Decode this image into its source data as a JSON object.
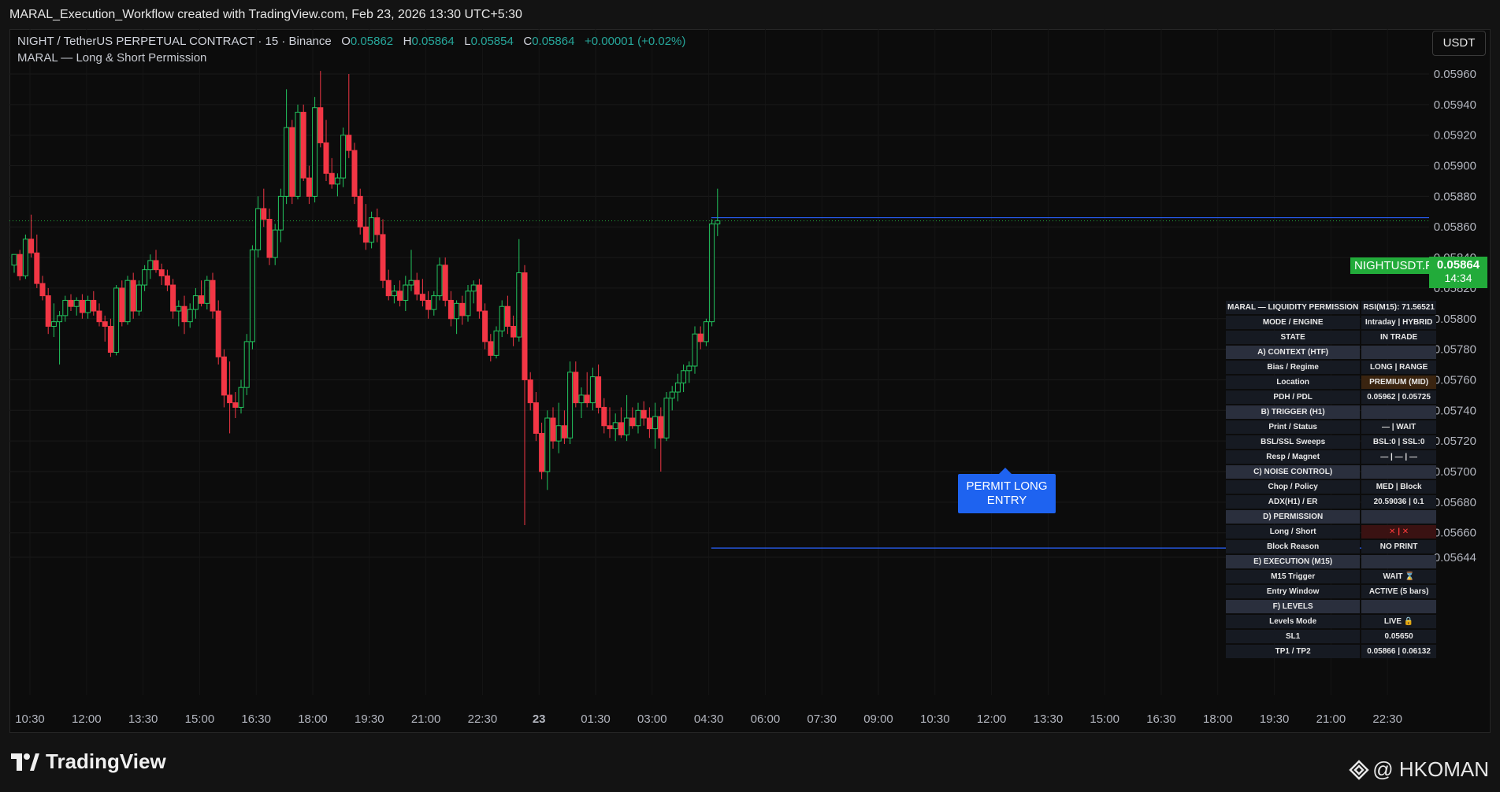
{
  "window": {
    "title": "MARAL_Execution_Workflow created with TradingView.com, Feb 23, 2026 13:30 UTC+5:30"
  },
  "legend": {
    "symbol": "NIGHT / TetherUS PERPETUAL CONTRACT · 15 · Binance",
    "o_label": "O",
    "o_value": "0.05862",
    "h_label": "H",
    "h_value": "0.05864",
    "l_label": "L",
    "l_value": "0.05854",
    "c_label": "C",
    "c_value": "0.05864",
    "change": "+0.00001 (+0.02%)",
    "indicator": "MARAL — Long & Short Permission"
  },
  "currency_button": "USDT",
  "last_price": {
    "symbol": "NIGHTUSDT.P",
    "price": "0.05864",
    "countdown": "14:34"
  },
  "signal_label": {
    "line1": "PERMIT LONG",
    "line2": "ENTRY"
  },
  "dashboard": {
    "rows": [
      {
        "k": "MARAL — LIQUIDITY PERMISSION",
        "v": "RSI(M15): 71.56521",
        "type": "header"
      },
      {
        "k": "MODE / ENGINE",
        "v": "Intraday | HYBRID"
      },
      {
        "k": "STATE",
        "v": "IN TRADE"
      },
      {
        "k": "A) CONTEXT (HTF)",
        "v": "",
        "type": "section"
      },
      {
        "k": "Bias / Regime",
        "v": "LONG | RANGE"
      },
      {
        "k": "Location",
        "v": "PREMIUM (MID)",
        "hl": "prem"
      },
      {
        "k": "PDH / PDL",
        "v": "0.05962 | 0.05725"
      },
      {
        "k": "B) TRIGGER (H1)",
        "v": "",
        "type": "section"
      },
      {
        "k": "Print / Status",
        "v": "— | WAIT"
      },
      {
        "k": "BSL/SSL Sweeps",
        "v": "BSL:0 | SSL:0"
      },
      {
        "k": "Resp / Magnet",
        "v": "— | — | —"
      },
      {
        "k": "C) NOISE CONTROL)",
        "v": "",
        "type": "section"
      },
      {
        "k": "Chop / Policy",
        "v": "MED | Block"
      },
      {
        "k": "ADX(H1) / ER",
        "v": "20.59036 | 0.1"
      },
      {
        "k": "D) PERMISSION",
        "v": "",
        "type": "section"
      },
      {
        "k": "Long / Short",
        "v": "✕ | ✕",
        "hl": "perm"
      },
      {
        "k": "Block Reason",
        "v": "NO PRINT"
      },
      {
        "k": "E) EXECUTION (M15)",
        "v": "",
        "type": "section"
      },
      {
        "k": "M15 Trigger",
        "v": "WAIT ⌛"
      },
      {
        "k": "Entry Window",
        "v": "ACTIVE (5 bars)"
      },
      {
        "k": "F) LEVELS",
        "v": "",
        "type": "section"
      },
      {
        "k": "Levels Mode",
        "v": "LIVE 🔒"
      },
      {
        "k": "SL1",
        "v": "0.05650"
      },
      {
        "k": "TP1 / TP2",
        "v": "0.05866 | 0.06132"
      }
    ]
  },
  "branding": {
    "logo_text": "TradingView",
    "watermark": "@ HKOMAN"
  },
  "colors": {
    "up": "#26a69a",
    "bull_body": "#0c0c0c",
    "bull_outline": "#22c55e",
    "down": "#f23645",
    "accent": "#2962ff",
    "last_price_bg": "#22ab3a"
  },
  "chart_data": {
    "type": "candlestick",
    "interval": "15",
    "exchange": "Binance",
    "ylim": [
      0.0564,
      0.0597
    ],
    "y_ticks": [
      "0.05960",
      "0.05940",
      "0.05920",
      "0.05900",
      "0.05880",
      "0.05860",
      "0.05840",
      "0.05820",
      "0.05800",
      "0.05780",
      "0.05760",
      "0.05740",
      "0.05720",
      "0.05700",
      "0.05680",
      "0.05660",
      "0.05644"
    ],
    "x_ticks": [
      "10:30",
      "12:00",
      "13:30",
      "15:00",
      "16:30",
      "18:00",
      "19:30",
      "21:00",
      "22:30",
      "23",
      "01:30",
      "03:00",
      "04:30",
      "06:00",
      "07:30",
      "09:00",
      "10:30",
      "12:00",
      "13:30",
      "15:00",
      "16:30",
      "18:00",
      "19:30",
      "21:00",
      "22:30"
    ],
    "last_close": 0.05864,
    "levels": {
      "tp1": 0.05866,
      "sl1": 0.0565
    },
    "signal_index": 123,
    "candles": [
      [
        0.05835,
        0.05842,
        0.0583,
        0.05842
      ],
      [
        0.05842,
        0.05845,
        0.05825,
        0.05828
      ],
      [
        0.05828,
        0.05855,
        0.05826,
        0.05852
      ],
      [
        0.05852,
        0.05868,
        0.0584,
        0.05843
      ],
      [
        0.05843,
        0.05855,
        0.0582,
        0.05823
      ],
      [
        0.05823,
        0.05828,
        0.05812,
        0.05815
      ],
      [
        0.05815,
        0.0582,
        0.0579,
        0.05795
      ],
      [
        0.05795,
        0.0581,
        0.05788,
        0.05798
      ],
      [
        0.05798,
        0.05805,
        0.0577,
        0.05802
      ],
      [
        0.05802,
        0.05815,
        0.05798,
        0.05812
      ],
      [
        0.05812,
        0.05816,
        0.05805,
        0.05808
      ],
      [
        0.05808,
        0.05814,
        0.05802,
        0.05812
      ],
      [
        0.05812,
        0.05816,
        0.058,
        0.05804
      ],
      [
        0.05804,
        0.05815,
        0.058,
        0.05812
      ],
      [
        0.05812,
        0.05818,
        0.05802,
        0.05805
      ],
      [
        0.05805,
        0.0581,
        0.05795,
        0.05798
      ],
      [
        0.05798,
        0.05802,
        0.05785,
        0.05795
      ],
      [
        0.05795,
        0.058,
        0.05775,
        0.05778
      ],
      [
        0.05778,
        0.05822,
        0.05776,
        0.0582
      ],
      [
        0.0582,
        0.05825,
        0.05795,
        0.05798
      ],
      [
        0.05798,
        0.05828,
        0.05796,
        0.05825
      ],
      [
        0.05825,
        0.0583,
        0.058,
        0.05805
      ],
      [
        0.05805,
        0.05825,
        0.05802,
        0.05822
      ],
      [
        0.05822,
        0.05835,
        0.05818,
        0.05832
      ],
      [
        0.05832,
        0.05842,
        0.05826,
        0.05838
      ],
      [
        0.05838,
        0.05845,
        0.0583,
        0.05832
      ],
      [
        0.05832,
        0.05836,
        0.05822,
        0.05828
      ],
      [
        0.05828,
        0.05832,
        0.05818,
        0.05822
      ],
      [
        0.05822,
        0.05826,
        0.058,
        0.05805
      ],
      [
        0.05805,
        0.05812,
        0.05795,
        0.05808
      ],
      [
        0.05808,
        0.05815,
        0.0579,
        0.05798
      ],
      [
        0.05798,
        0.0581,
        0.05794,
        0.05806
      ],
      [
        0.05806,
        0.0582,
        0.058,
        0.05815
      ],
      [
        0.05815,
        0.05825,
        0.05808,
        0.0581
      ],
      [
        0.0581,
        0.05828,
        0.05806,
        0.05825
      ],
      [
        0.05825,
        0.0583,
        0.058,
        0.05805
      ],
      [
        0.05805,
        0.05812,
        0.0577,
        0.05775
      ],
      [
        0.05775,
        0.0578,
        0.05742,
        0.0575
      ],
      [
        0.0575,
        0.05772,
        0.05725,
        0.05745
      ],
      [
        0.05745,
        0.05752,
        0.05735,
        0.05742
      ],
      [
        0.05742,
        0.0576,
        0.05738,
        0.05755
      ],
      [
        0.05755,
        0.0579,
        0.0575,
        0.05785
      ],
      [
        0.05785,
        0.05848,
        0.0578,
        0.05845
      ],
      [
        0.05845,
        0.0588,
        0.0584,
        0.05872
      ],
      [
        0.05872,
        0.05885,
        0.0586,
        0.05865
      ],
      [
        0.05865,
        0.05872,
        0.05835,
        0.0584
      ],
      [
        0.0584,
        0.05862,
        0.05835,
        0.05858
      ],
      [
        0.05858,
        0.05885,
        0.0585,
        0.0588
      ],
      [
        0.0588,
        0.0595,
        0.05875,
        0.05925
      ],
      [
        0.05925,
        0.0593,
        0.05875,
        0.0588
      ],
      [
        0.0588,
        0.0594,
        0.05878,
        0.05935
      ],
      [
        0.05935,
        0.0594,
        0.0589,
        0.05892
      ],
      [
        0.05892,
        0.059,
        0.05875,
        0.0588
      ],
      [
        0.0588,
        0.05945,
        0.05876,
        0.05938
      ],
      [
        0.05938,
        0.05962,
        0.05912,
        0.05915
      ],
      [
        0.05915,
        0.0593,
        0.0589,
        0.05895
      ],
      [
        0.05895,
        0.05905,
        0.05885,
        0.05888
      ],
      [
        0.05888,
        0.05895,
        0.0588,
        0.05892
      ],
      [
        0.05892,
        0.05925,
        0.05886,
        0.0592
      ],
      [
        0.0592,
        0.0596,
        0.05905,
        0.0591
      ],
      [
        0.0591,
        0.05915,
        0.05875,
        0.0588
      ],
      [
        0.0588,
        0.05885,
        0.05855,
        0.0586
      ],
      [
        0.0586,
        0.05875,
        0.05845,
        0.0585
      ],
      [
        0.0585,
        0.0587,
        0.05846,
        0.05866
      ],
      [
        0.05866,
        0.05872,
        0.0585,
        0.05855
      ],
      [
        0.05855,
        0.05865,
        0.0582,
        0.05825
      ],
      [
        0.05825,
        0.05832,
        0.05812,
        0.05815
      ],
      [
        0.05815,
        0.05822,
        0.0581,
        0.05818
      ],
      [
        0.05818,
        0.05825,
        0.05808,
        0.05812
      ],
      [
        0.05812,
        0.05828,
        0.05805,
        0.05822
      ],
      [
        0.05822,
        0.05845,
        0.05818,
        0.05825
      ],
      [
        0.05825,
        0.0583,
        0.05812,
        0.05816
      ],
      [
        0.05816,
        0.05826,
        0.05808,
        0.05812
      ],
      [
        0.05812,
        0.05818,
        0.058,
        0.05806
      ],
      [
        0.05806,
        0.05818,
        0.05802,
        0.05815
      ],
      [
        0.05815,
        0.0584,
        0.05812,
        0.05835
      ],
      [
        0.05835,
        0.0584,
        0.05808,
        0.05812
      ],
      [
        0.05812,
        0.05818,
        0.05795,
        0.058
      ],
      [
        0.058,
        0.05812,
        0.0579,
        0.0581
      ],
      [
        0.0581,
        0.05815,
        0.05796,
        0.05802
      ],
      [
        0.05802,
        0.05822,
        0.05798,
        0.05818
      ],
      [
        0.05818,
        0.05825,
        0.0581,
        0.05822
      ],
      [
        0.05822,
        0.05826,
        0.058,
        0.05805
      ],
      [
        0.05805,
        0.0581,
        0.0578,
        0.05785
      ],
      [
        0.05785,
        0.0579,
        0.05772,
        0.05776
      ],
      [
        0.05776,
        0.05795,
        0.05774,
        0.05792
      ],
      [
        0.05792,
        0.05812,
        0.05788,
        0.05808
      ],
      [
        0.05808,
        0.05815,
        0.0579,
        0.05795
      ],
      [
        0.05795,
        0.05802,
        0.05782,
        0.05788
      ],
      [
        0.05788,
        0.05852,
        0.05785,
        0.0583
      ],
      [
        0.0583,
        0.05835,
        0.05665,
        0.0576
      ],
      [
        0.0576,
        0.05765,
        0.0574,
        0.05745
      ],
      [
        0.05745,
        0.05752,
        0.0572,
        0.05725
      ],
      [
        0.05725,
        0.05732,
        0.05695,
        0.057
      ],
      [
        0.057,
        0.0574,
        0.05688,
        0.05735
      ],
      [
        0.05735,
        0.05742,
        0.05715,
        0.0572
      ],
      [
        0.0572,
        0.05745,
        0.05712,
        0.0573
      ],
      [
        0.0573,
        0.0574,
        0.05718,
        0.05722
      ],
      [
        0.05722,
        0.05772,
        0.05718,
        0.05765
      ],
      [
        0.05765,
        0.05772,
        0.05742,
        0.05745
      ],
      [
        0.05745,
        0.05755,
        0.05735,
        0.0575
      ],
      [
        0.0575,
        0.05765,
        0.05742,
        0.05745
      ],
      [
        0.05745,
        0.05768,
        0.0574,
        0.05762
      ],
      [
        0.05762,
        0.0577,
        0.05738,
        0.05742
      ],
      [
        0.05742,
        0.05748,
        0.05725,
        0.0573
      ],
      [
        0.0573,
        0.05742,
        0.05722,
        0.05728
      ],
      [
        0.05728,
        0.05738,
        0.0572,
        0.05732
      ],
      [
        0.05732,
        0.05742,
        0.05722,
        0.05724
      ],
      [
        0.05724,
        0.0575,
        0.0572,
        0.05735
      ],
      [
        0.05735,
        0.05742,
        0.05728,
        0.0573
      ],
      [
        0.0573,
        0.05745,
        0.05725,
        0.0574
      ],
      [
        0.0574,
        0.05746,
        0.0573,
        0.05735
      ],
      [
        0.05735,
        0.05742,
        0.05722,
        0.05728
      ],
      [
        0.05728,
        0.05745,
        0.05715,
        0.05736
      ],
      [
        0.05736,
        0.05742,
        0.057,
        0.05722
      ],
      [
        0.05722,
        0.05752,
        0.0572,
        0.05748
      ],
      [
        0.05748,
        0.05756,
        0.0574,
        0.05752
      ],
      [
        0.05752,
        0.05764,
        0.05746,
        0.05758
      ],
      [
        0.05758,
        0.0577,
        0.05752,
        0.05766
      ],
      [
        0.05766,
        0.05772,
        0.05758,
        0.05769
      ],
      [
        0.05769,
        0.05795,
        0.05764,
        0.0579
      ],
      [
        0.0579,
        0.05795,
        0.0578,
        0.05785
      ],
      [
        0.05785,
        0.058,
        0.05782,
        0.05798
      ],
      [
        0.05798,
        0.05865,
        0.05795,
        0.05862
      ],
      [
        0.05862,
        0.05885,
        0.05854,
        0.05864
      ]
    ]
  }
}
